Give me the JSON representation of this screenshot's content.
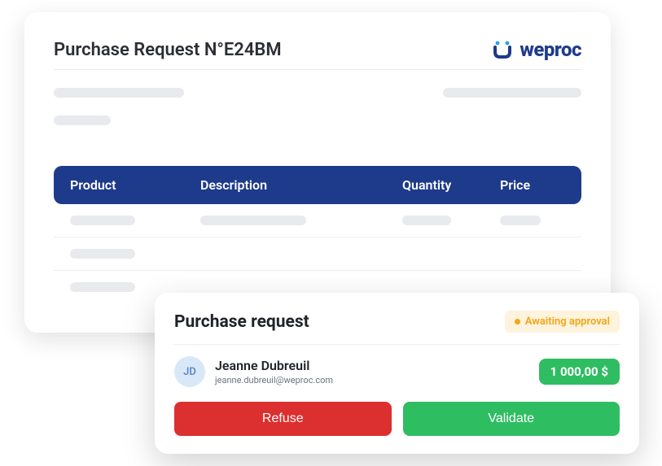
{
  "main": {
    "title": "Purchase Request N°E24BM",
    "brand": "weproc"
  },
  "table": {
    "headers": {
      "product": "Product",
      "description": "Description",
      "quantity": "Quantity",
      "price": "Price"
    }
  },
  "approval": {
    "title": "Purchase request",
    "status": "Awaiting approval",
    "user": {
      "initials": "JD",
      "name": "Jeanne Dubreuil",
      "email": "jeanne.dubreuil@weproc.com"
    },
    "amount": "1 000,00 $",
    "actions": {
      "refuse": "Refuse",
      "validate": "Validate"
    }
  }
}
